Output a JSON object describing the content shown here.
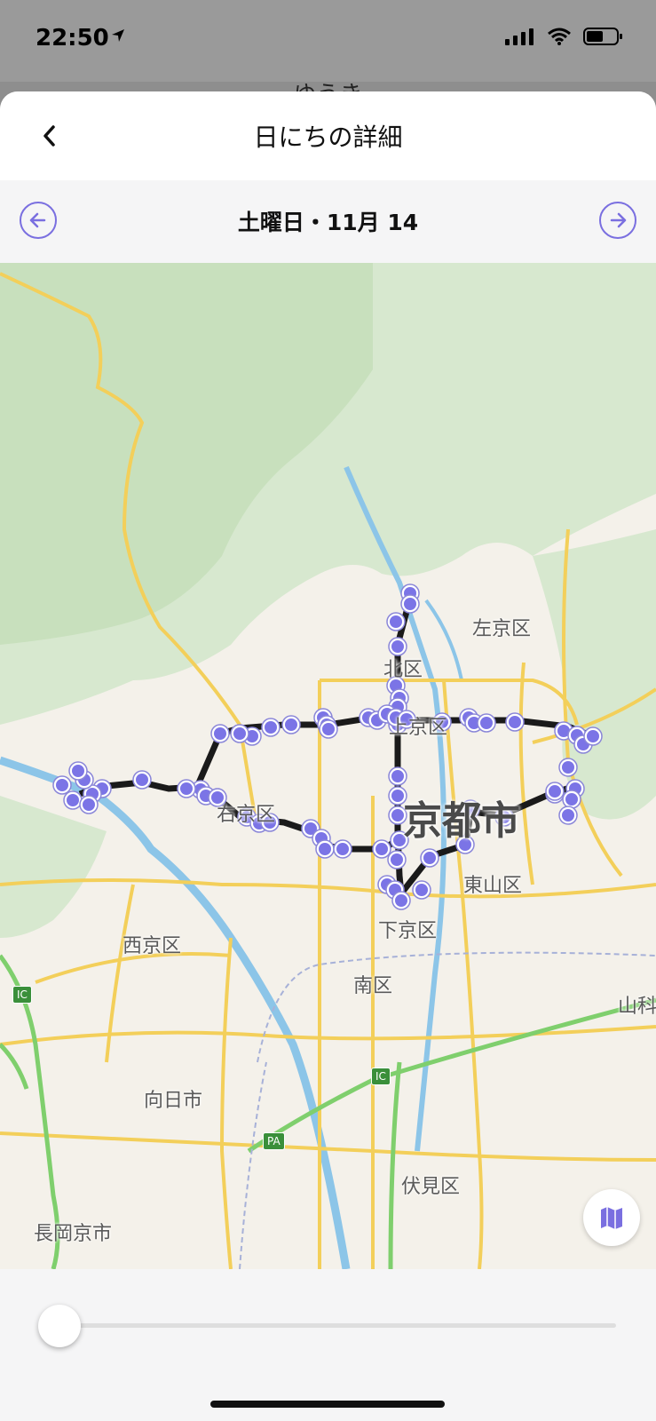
{
  "status": {
    "time": "22:50"
  },
  "background_title": "ゆうき",
  "header": {
    "title": "日にちの詳細"
  },
  "date_nav": {
    "label": "土曜日・11月 14"
  },
  "map": {
    "labels": {
      "sakyo": "左京区",
      "kita": "北区",
      "kamigyo": "上京区",
      "city": "京都市",
      "ukyo": "右京区",
      "higashiyama": "東山区",
      "shimogyo": "下京区",
      "nishikyo": "西京区",
      "minami": "南区",
      "yamashina": "山科",
      "muko": "向日市",
      "fushimi": "伏見区",
      "nagaokakyo": "長岡京市",
      "ic1": "IC",
      "ic2": "IC",
      "pa": "PA"
    }
  },
  "slider": {
    "position": 0
  },
  "colors": {
    "accent": "#7a6fe0",
    "route": "#1a1a1a",
    "point": "#7b74e6"
  }
}
